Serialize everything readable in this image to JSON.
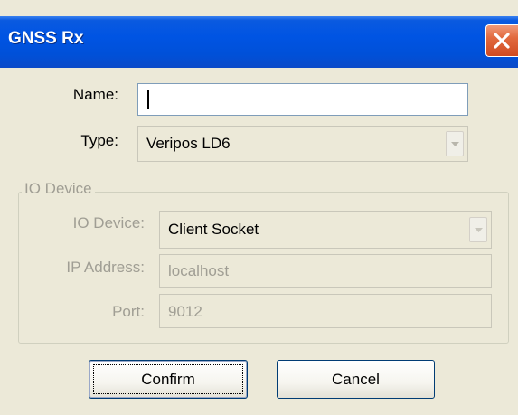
{
  "window": {
    "title": "GNSS Rx"
  },
  "form": {
    "name_label": "Name:",
    "name_value": "",
    "type_label": "Type:",
    "type_value": "Veripos LD6"
  },
  "io_group": {
    "legend": "IO Device",
    "device_label": "IO Device:",
    "device_value": "Client Socket",
    "ip_label": "IP Address:",
    "ip_value": "localhost",
    "port_label": "Port:",
    "port_value": "9012"
  },
  "buttons": {
    "confirm": "Confirm",
    "cancel": "Cancel"
  },
  "colors": {
    "titlebar": "#0054e3",
    "close": "#e26a3f",
    "dialog_bg": "#ece9d8",
    "disabled_text": "#a09e94"
  },
  "icons": {
    "close": "close-icon",
    "dropdown": "chevron-down-icon"
  }
}
